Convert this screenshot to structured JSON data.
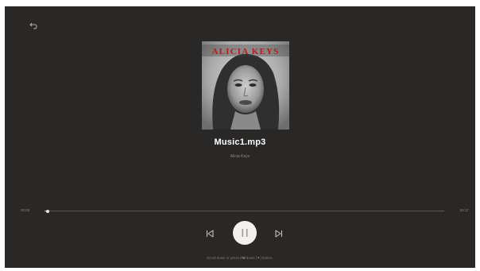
{
  "track": {
    "title": "Music1.mp3",
    "artist": "Alicia Keys",
    "album_art_text": "ALICIA KEYS"
  },
  "playback": {
    "elapsed": "00:02",
    "total": "04:17",
    "progress": 0.008,
    "state": "playing"
  },
  "hint": {
    "text": "Scroll down or press the down [▼] button."
  },
  "icons": {
    "back": "back-arrow-icon",
    "previous": "skip-previous-icon",
    "play_pause": "pause-icon",
    "next": "skip-next-icon",
    "hint": "chevron-down-icon"
  },
  "colors": {
    "background": "#2a2826",
    "title": "#ffffff",
    "secondary_text": "#8d8a86",
    "control_circle": "#f3f1ee"
  }
}
